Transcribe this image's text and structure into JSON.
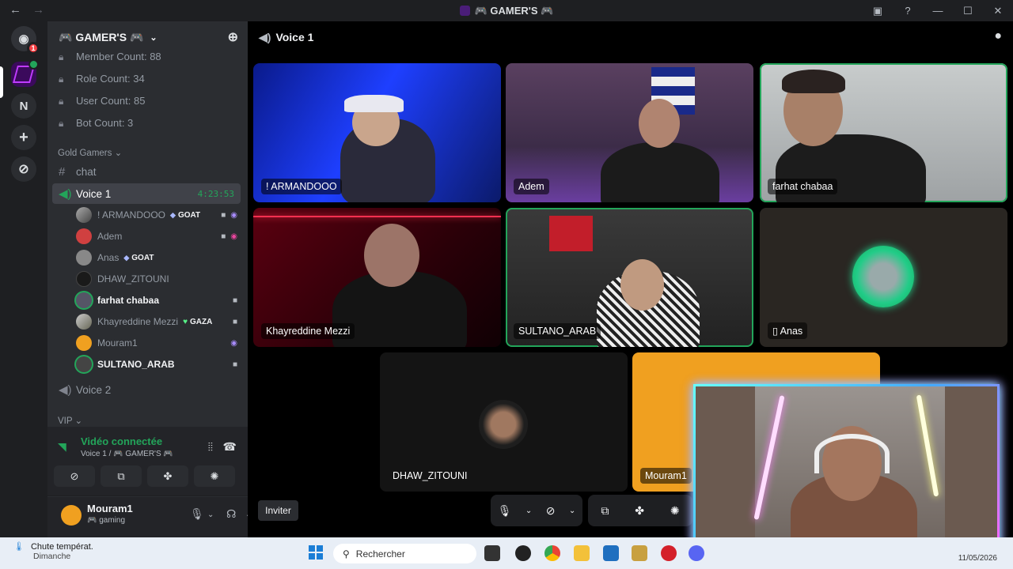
{
  "titlebar": {
    "back": "←",
    "forward": "→",
    "title": "🎮 GAMER'S 🎮",
    "icons": [
      "inbox-icon",
      "help-icon",
      "minimize-icon",
      "maximize-icon",
      "close-icon"
    ]
  },
  "guilds": {
    "dm_badge": "1",
    "n_server": "N"
  },
  "server": {
    "name": "🎮 GAMER'S 🎮",
    "stats": [
      "Member Count: 88",
      "Role Count: 34",
      "User Count: 85",
      "Bot Count: 3"
    ],
    "category": "Gold Gamers",
    "text_channel": "chat",
    "voice_channel": "Voice 1",
    "voice_timer": "4:23:53",
    "voice_channel_2": "Voice 2",
    "category_2": "VIP",
    "members": [
      {
        "name": "! ARMANDOOO",
        "tag": "GOAT"
      },
      {
        "name": "Adem",
        "tag": ""
      },
      {
        "name": "Anas",
        "tag": "GOAT"
      },
      {
        "name": "DHAW_ZITOUNI",
        "tag": ""
      },
      {
        "name": "farhat chabaa",
        "tag": ""
      },
      {
        "name": "Khayreddine Mezzi",
        "tag": "GAZA"
      },
      {
        "name": "Mouram1",
        "tag": ""
      },
      {
        "name": "SULTANO_ARAB",
        "tag": ""
      }
    ]
  },
  "voice_panel": {
    "status": "Vidéo connectée",
    "location": "Voice 1 / 🎮 GAMER'S 🎮"
  },
  "user_panel": {
    "name": "Mouram1",
    "status": "🎮 gaming"
  },
  "main": {
    "header": "Voice 1",
    "tiles": [
      "! ARMANDOOO",
      "Adem",
      "farhat chabaa",
      "Khayreddine Mezzi",
      "SULTANO_ARAB",
      "Anas",
      "DHAW_ZITOUNI",
      "Mouram1"
    ],
    "invite_label": "Inviter"
  },
  "taskbar": {
    "weather_title": "Chute températ.",
    "weather_day": "Dimanche",
    "search_placeholder": "Rechercher",
    "date": "11/05/2026"
  },
  "colors": {
    "accent_green": "#23a55a",
    "background": "#2b2d31",
    "server_purple": "#3b0a5c"
  }
}
